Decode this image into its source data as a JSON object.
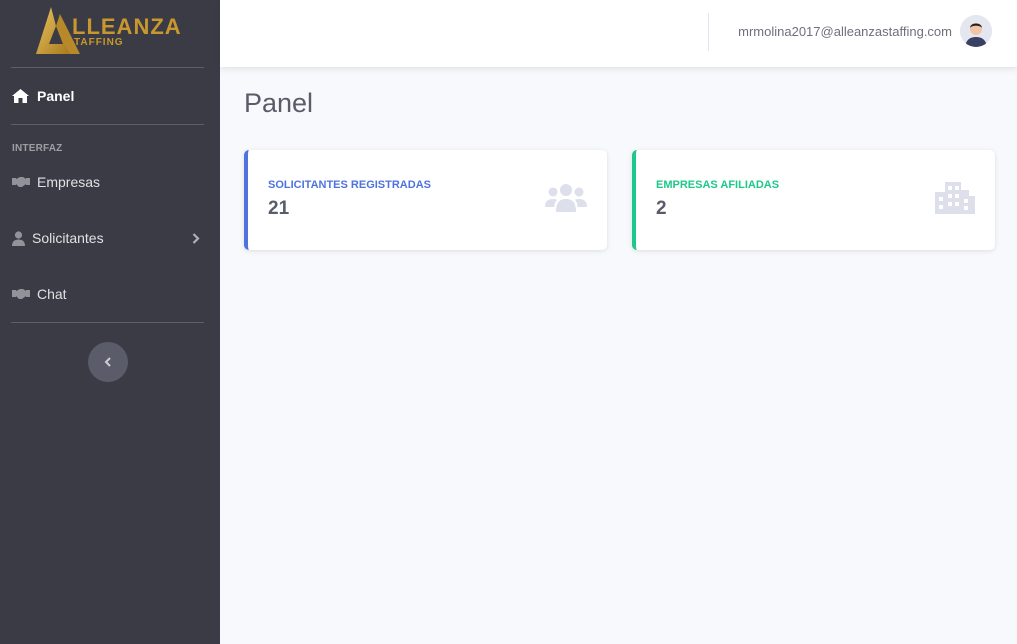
{
  "brand": {
    "name_main": "LLEANZA",
    "name_sub": "TAFFING",
    "accent": "#c8982e"
  },
  "sidebar": {
    "items": [
      {
        "label": "Panel",
        "icon": "home-icon"
      },
      {
        "label": "Empresas",
        "icon": "handshake-icon"
      },
      {
        "label": "Solicitantes",
        "icon": "user-icon"
      },
      {
        "label": "Chat",
        "icon": "handshake-icon"
      }
    ],
    "heading": "INTERFAZ"
  },
  "topbar": {
    "user_email": "mrmolina2017@alleanzastaffing.com"
  },
  "main": {
    "title": "Panel",
    "cards": [
      {
        "label": "SOLICITANTES REGISTRADAS",
        "value": "21",
        "color": "#4e73df",
        "icon": "users-icon"
      },
      {
        "label": "EMPRESAS AFILIADAS",
        "value": "2",
        "color": "#1cc88a",
        "icon": "building-icon"
      }
    ]
  }
}
